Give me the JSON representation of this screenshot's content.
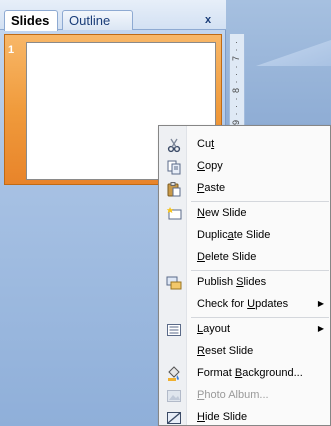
{
  "pane": {
    "tabs": [
      {
        "label": "Slides",
        "active": true
      },
      {
        "label": "Outline",
        "active": false
      }
    ],
    "close": "x",
    "slide_number": "1"
  },
  "ruler": {
    "text": "9 · · · 8 · · · 7 · ·"
  },
  "menu": {
    "items": [
      {
        "label": "Cut",
        "key": "t",
        "icon": "scissors-icon",
        "enabled": true
      },
      {
        "label": "Copy",
        "key": "C",
        "icon": "copy-icon",
        "enabled": true
      },
      {
        "label": "Paste",
        "key": "P",
        "icon": "paste-icon",
        "enabled": true
      },
      {
        "label": "New Slide",
        "key": "N",
        "icon": "new-slide-icon",
        "enabled": true
      },
      {
        "label": "Duplicate Slide",
        "key": "a",
        "icon": "",
        "enabled": true
      },
      {
        "label": "Delete Slide",
        "key": "D",
        "icon": "",
        "enabled": true
      },
      {
        "label": "Publish Slides",
        "key": "S",
        "icon": "publish-slides-icon",
        "enabled": true
      },
      {
        "label": "Check for Updates",
        "key": "U",
        "icon": "",
        "enabled": true,
        "submenu": true
      },
      {
        "label": "Layout",
        "key": "L",
        "icon": "layout-icon",
        "enabled": true,
        "submenu": true
      },
      {
        "label": "Reset Slide",
        "key": "R",
        "icon": "",
        "enabled": true
      },
      {
        "label": "Format Background...",
        "key": "B",
        "icon": "format-background-icon",
        "enabled": true
      },
      {
        "label": "Photo Album...",
        "key": "P",
        "icon": "photo-album-icon",
        "enabled": false
      },
      {
        "label": "Hide Slide",
        "key": "H",
        "icon": "hide-slide-icon",
        "enabled": true
      }
    ]
  }
}
